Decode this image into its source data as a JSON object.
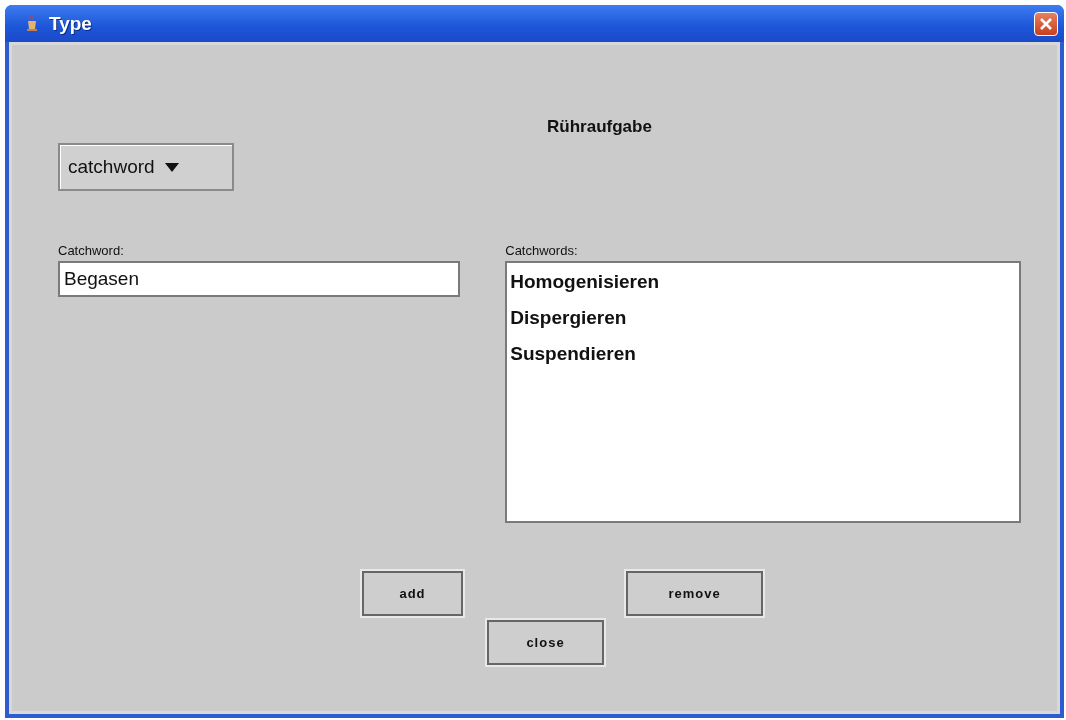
{
  "window": {
    "title": "Type"
  },
  "heading": "Rühraufgabe",
  "type_dropdown": {
    "value": "catchword"
  },
  "catchword_field": {
    "label": "Catchword:",
    "value": "Begasen"
  },
  "catchwords_list": {
    "label": "Catchwords:",
    "items": [
      "Homogenisieren",
      "Dispergieren",
      "Suspendieren"
    ]
  },
  "buttons": [
    "add",
    "remove",
    "close"
  ]
}
